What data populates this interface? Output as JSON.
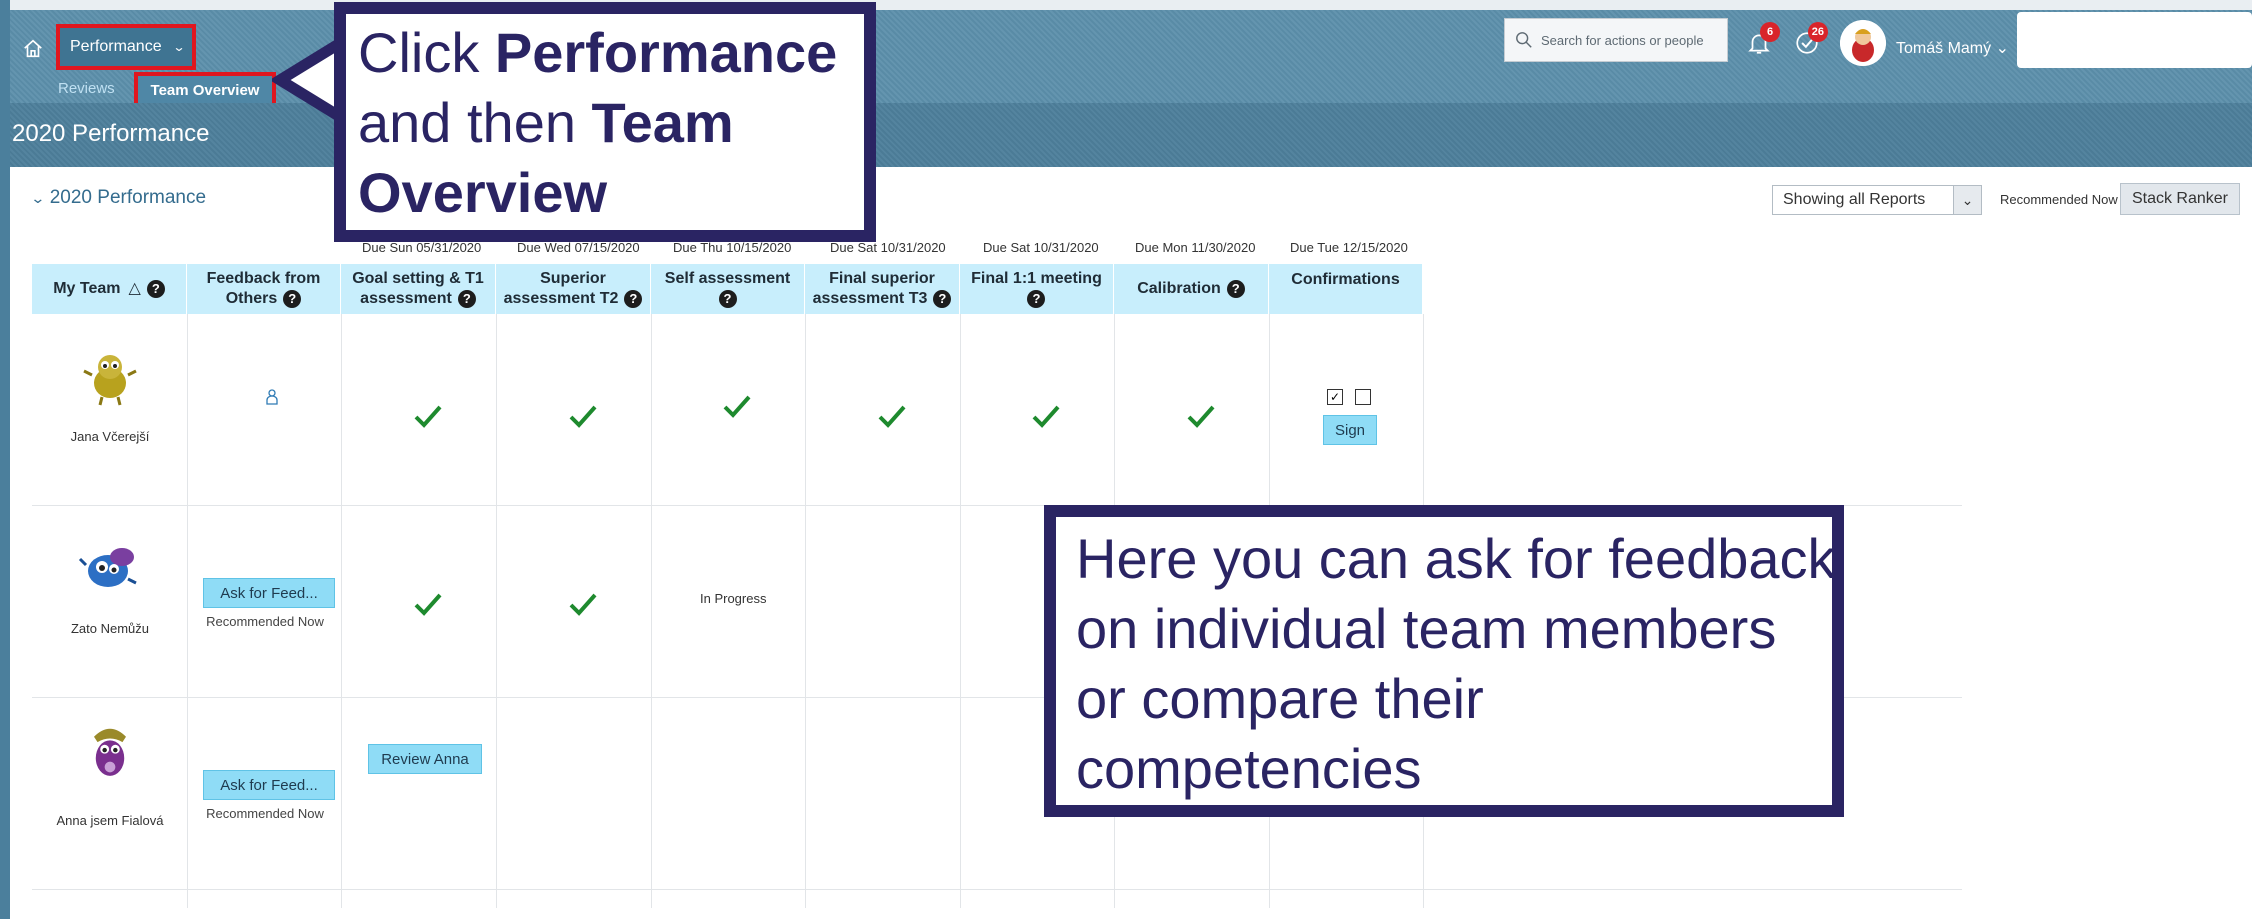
{
  "shell": {
    "app_menu_label": "Performance",
    "sub_tabs": [
      "Reviews",
      "Team Overview"
    ],
    "search_placeholder": "Search for actions or people",
    "notifications_count": "6",
    "todo_count": "26",
    "user_name": "Tomáš Mamý"
  },
  "page": {
    "title": "2020 Performance",
    "section_title": "2020 Performance",
    "reports_filter": "Showing all Reports",
    "recommended_now": "Recommended Now",
    "stack_ranker": "Stack Ranker"
  },
  "table": {
    "due_dates": [
      "Due Sun 05/31/2020",
      "Due Wed 07/15/2020",
      "Due Thu 10/15/2020",
      "Due Sat 10/31/2020",
      "Due Sat 10/31/2020",
      "Due Mon 11/30/2020",
      "Due Tue 12/15/2020"
    ],
    "headers": {
      "my_team": "My Team",
      "feedback": [
        "Feedback from",
        "Others"
      ],
      "goal": [
        "Goal setting & T1",
        "assessment"
      ],
      "superior_t2": [
        "Superior",
        "assessment T2"
      ],
      "self": "Self assessment",
      "final_t3": [
        "Final superior",
        "assessment T3"
      ],
      "final_meeting": "Final 1:1 meeting",
      "calibration": "Calibration",
      "confirmations": "Confirmations"
    },
    "members": [
      {
        "name": "Jana Včerejší",
        "sign_label": "Sign"
      },
      {
        "name": "Zato Nemůžu",
        "ask_label": "Ask for Feed...",
        "recommended": "Recommended Now",
        "self_status": "In Progress"
      },
      {
        "name": "Anna jsem Fialová",
        "ask_label": "Ask for Feed...",
        "recommended": "Recommended Now",
        "review_label": "Review Anna"
      }
    ]
  },
  "callouts": {
    "top": {
      "line1_plain": "Click ",
      "line1_bold": "Performance",
      "line2_plain": "and then ",
      "line2_bold": "Team",
      "line3_bold": "Overview"
    },
    "bottom": "Here you can ask for feedback on individual team members or compare their competencies"
  },
  "colors": {
    "callout": "#2a2463",
    "highlight_red": "#e0161f",
    "check_green": "#1e8a2e",
    "header_cyan": "#c8eefc",
    "button_cyan": "#8fdcf6"
  }
}
